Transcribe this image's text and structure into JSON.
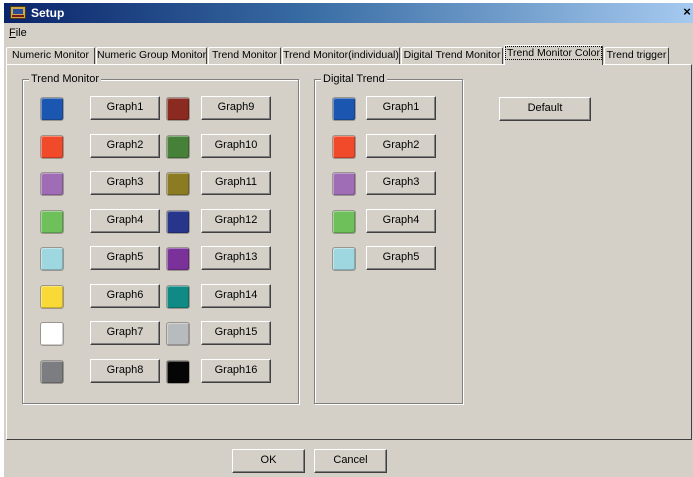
{
  "window": {
    "title": "Setup",
    "close_label": "×"
  },
  "menu": {
    "file_accel": "F",
    "file_rest": "ile"
  },
  "tabs": [
    {
      "label": "Numeric Monitor"
    },
    {
      "label": "Numeric Group Monitor"
    },
    {
      "label": "Trend Monitor"
    },
    {
      "label": "Trend Monitor(individual)"
    },
    {
      "label": "Digital Trend Monitor"
    },
    {
      "label": "Trend Monitor Color",
      "active": true
    },
    {
      "label": "Trend trigger"
    }
  ],
  "trend_monitor": {
    "title": "Trend Monitor",
    "graphs": [
      {
        "label": "Graph1",
        "color": "#1b57b0"
      },
      {
        "label": "Graph2",
        "color": "#f14a2b"
      },
      {
        "label": "Graph3",
        "color": "#9f6cb6"
      },
      {
        "label": "Graph4",
        "color": "#6ec05a"
      },
      {
        "label": "Graph5",
        "color": "#9fd7e1"
      },
      {
        "label": "Graph6",
        "color": "#f9d937"
      },
      {
        "label": "Graph7",
        "color": "#ffffff"
      },
      {
        "label": "Graph8",
        "color": "#7b7d80"
      },
      {
        "label": "Graph9",
        "color": "#8b2a20"
      },
      {
        "label": "Graph10",
        "color": "#468039"
      },
      {
        "label": "Graph11",
        "color": "#8b7c23"
      },
      {
        "label": "Graph12",
        "color": "#27368a"
      },
      {
        "label": "Graph13",
        "color": "#7b319a"
      },
      {
        "label": "Graph14",
        "color": "#0f8a84"
      },
      {
        "label": "Graph15",
        "color": "#b8bbbe"
      },
      {
        "label": "Graph16",
        "color": "#050505"
      }
    ]
  },
  "digital_trend": {
    "title": "Digital Trend",
    "graphs": [
      {
        "label": "Graph1",
        "color": "#1b57b0"
      },
      {
        "label": "Graph2",
        "color": "#f14a2b"
      },
      {
        "label": "Graph3",
        "color": "#9f6cb6"
      },
      {
        "label": "Graph4",
        "color": "#6ec05a"
      },
      {
        "label": "Graph5",
        "color": "#9fd7e1"
      }
    ]
  },
  "buttons": {
    "default": "Default",
    "ok": "OK",
    "cancel": "Cancel"
  }
}
